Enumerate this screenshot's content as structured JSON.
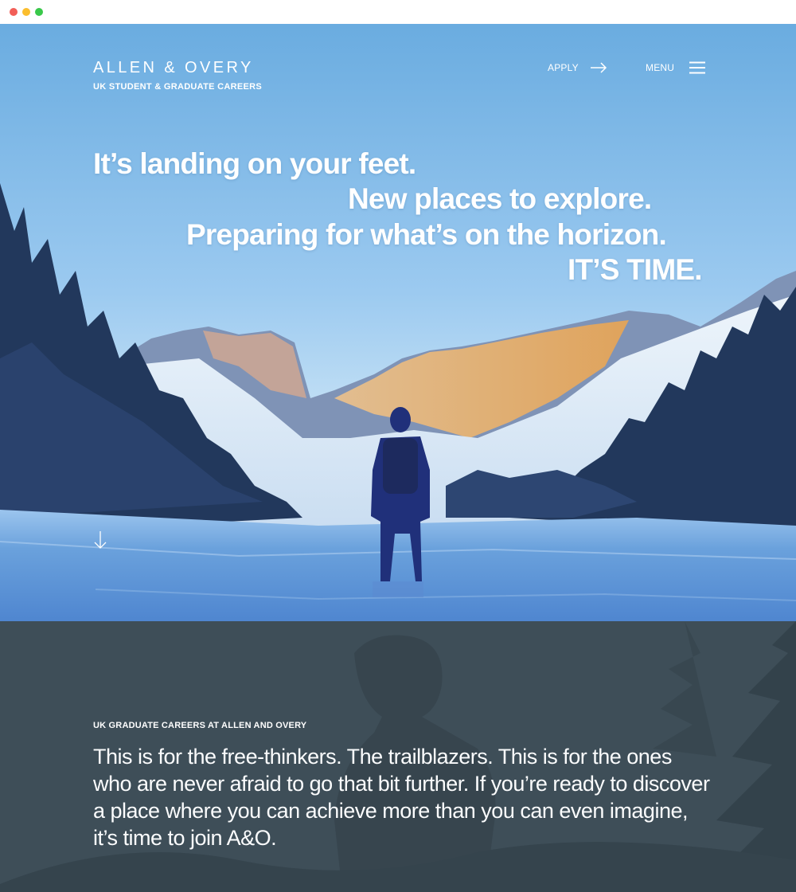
{
  "window": {
    "controls": [
      "close",
      "minimize",
      "maximize"
    ],
    "colors": {
      "close": "#f25f58",
      "minimize": "#fbbe2e",
      "maximize": "#39c84a"
    }
  },
  "header": {
    "brand": "ALLEN & OVERY",
    "subtitle": "UK STUDENT & GRADUATE CAREERS",
    "apply_label": "APPLY",
    "apply_icon": "arrow-right-icon",
    "menu_label": "MENU",
    "menu_icon": "hamburger-icon"
  },
  "hero": {
    "lines": [
      "It’s landing on your feet.",
      "New places to explore.",
      "Preparing for what’s on the horizon.",
      "IT’S TIME."
    ],
    "scroll_icon": "arrow-down-icon",
    "sky_color": "#6fb2e3",
    "ice_color": "#5b92d3"
  },
  "intro": {
    "eyebrow": "UK GRADUATE CAREERS AT ALLEN AND OVERY",
    "body": "This is for the free-thinkers. The trailblazers. This is for the ones who are never afraid to go that bit further. If you’re ready to discover a place where you can achieve more than you can even imagine, it’s time to join A&O.",
    "background_color": "#3d4d57"
  }
}
